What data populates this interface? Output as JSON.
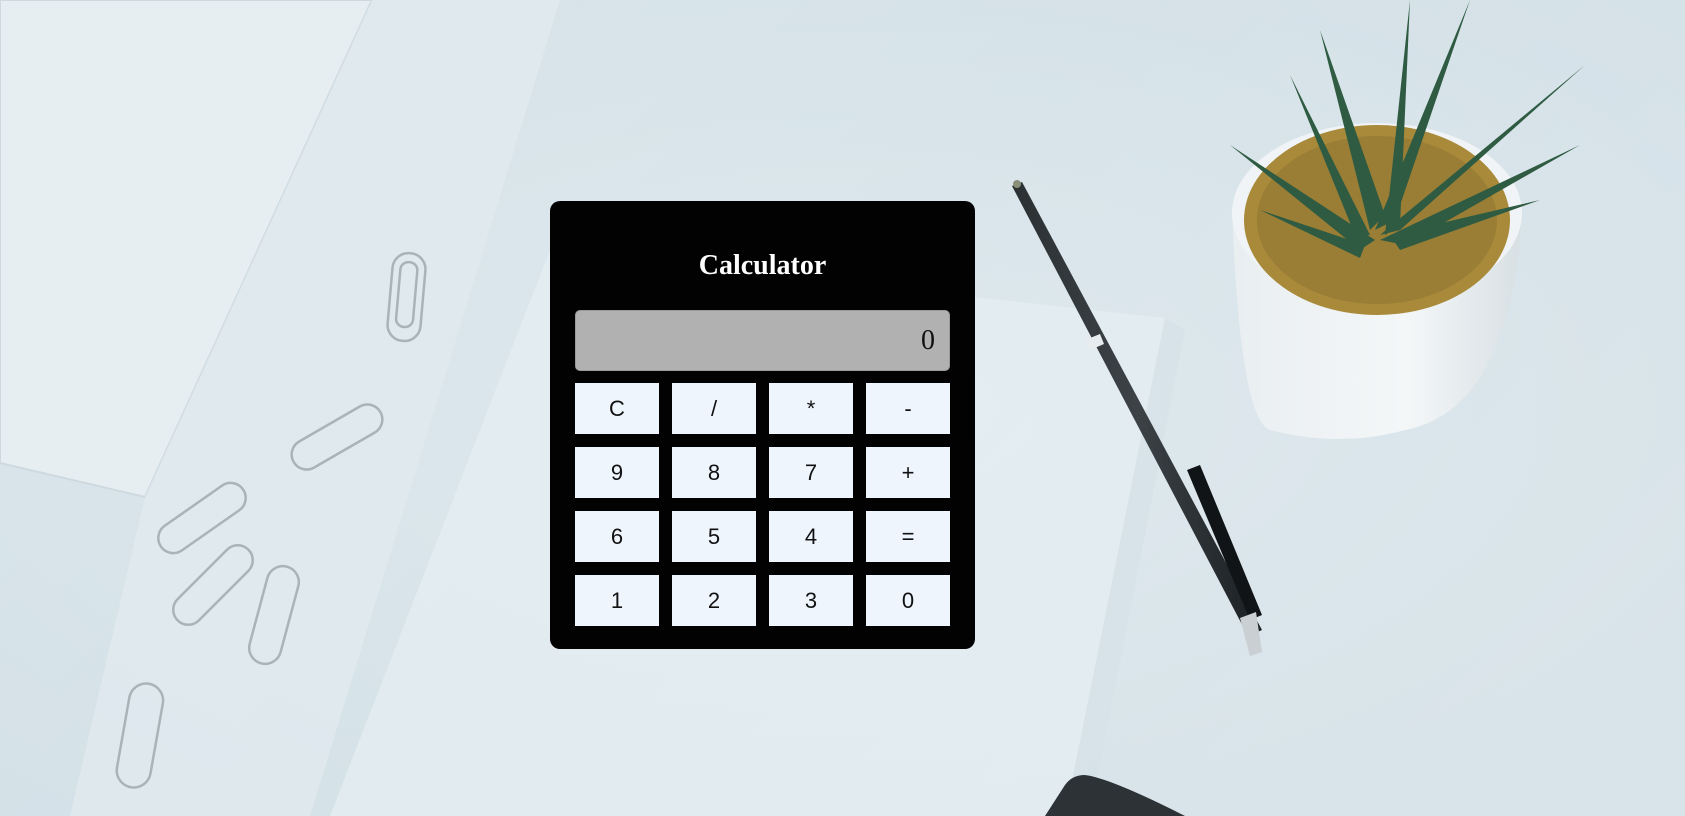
{
  "calculator": {
    "title": "Calculator",
    "display_value": "0",
    "keys": [
      "C",
      "/",
      "*",
      "-",
      "9",
      "8",
      "7",
      "+",
      "6",
      "5",
      "4",
      "=",
      "1",
      "2",
      "3",
      "0"
    ]
  },
  "colors": {
    "panel": "#030203",
    "display": "#b1b1b1",
    "key": "#eef5fd",
    "title": "#ffffff",
    "background": "#dfe9ee"
  },
  "background_photo": {
    "icons": [
      "paper-sheet-icon",
      "paperclip-icon",
      "pen-icon",
      "potted-plant-icon",
      "device-corner-icon"
    ]
  }
}
